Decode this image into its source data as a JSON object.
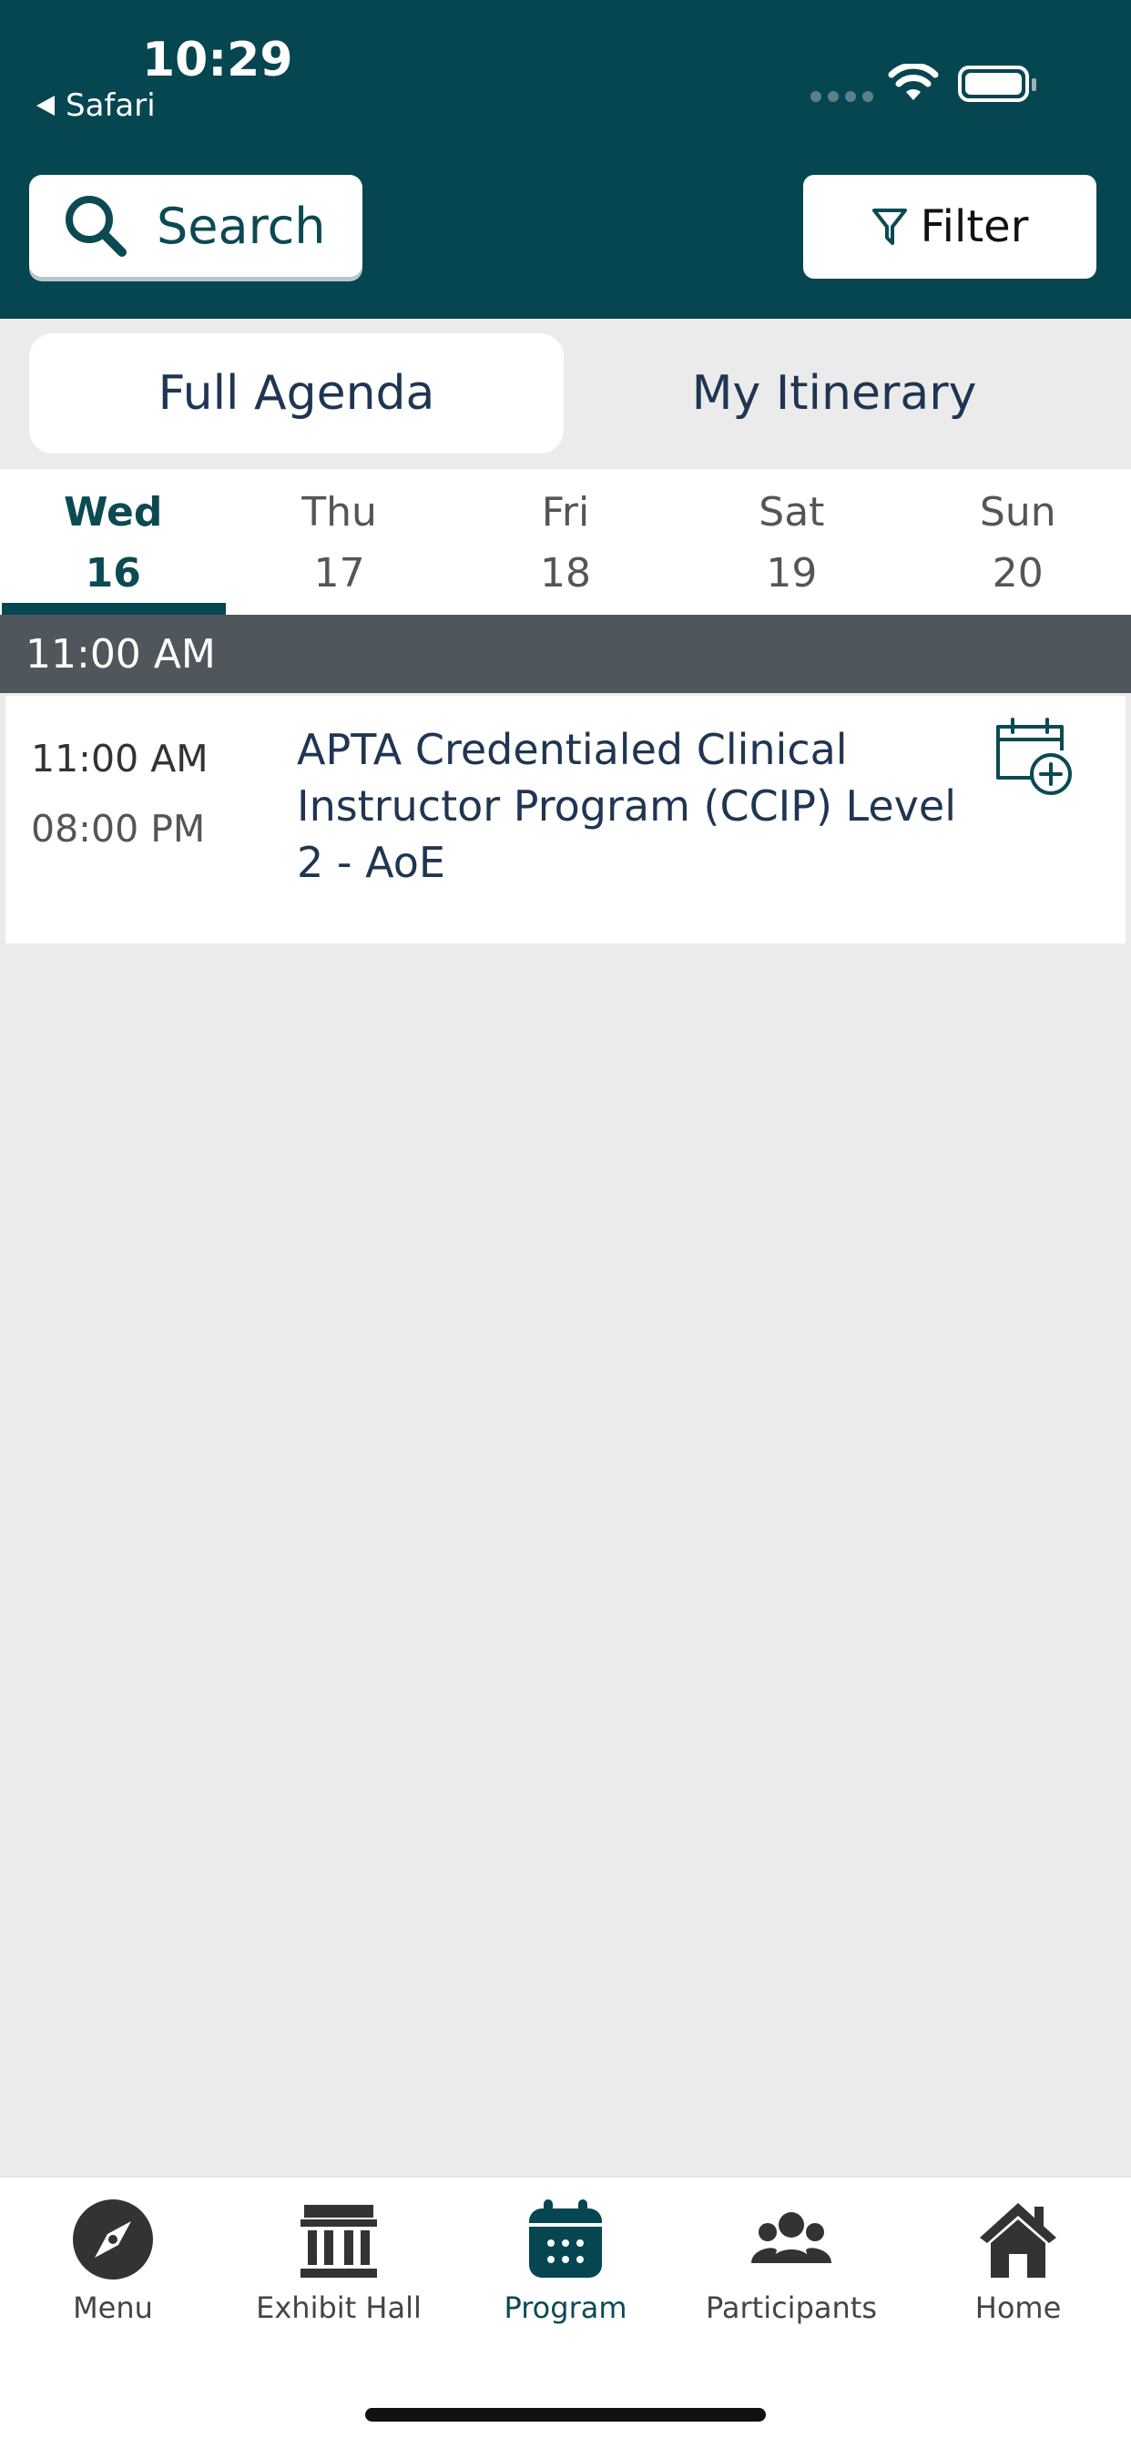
{
  "status": {
    "time": "10:29",
    "back_app": "Safari"
  },
  "header": {
    "search_label": "Search",
    "filter_label": "Filter"
  },
  "segments": {
    "active": "Full Agenda",
    "inactive": "My Itinerary"
  },
  "days": [
    {
      "dow": "Wed",
      "num": "16"
    },
    {
      "dow": "Thu",
      "num": "17"
    },
    {
      "dow": "Fri",
      "num": "18"
    },
    {
      "dow": "Sat",
      "num": "19"
    },
    {
      "dow": "Sun",
      "num": "20"
    }
  ],
  "timeslot": {
    "label": "11:00 AM"
  },
  "session": {
    "start": "11:00 AM",
    "end": "08:00 PM",
    "title": "APTA Credentialed Clinical Instructor Program (CCIP) Level 2 - AoE"
  },
  "nav": [
    {
      "label": "Menu",
      "icon": "compass-icon"
    },
    {
      "label": "Exhibit Hall",
      "icon": "building-icon"
    },
    {
      "label": "Program",
      "icon": "calendar-icon"
    },
    {
      "label": "Participants",
      "icon": "people-icon"
    },
    {
      "label": "Home",
      "icon": "home-icon"
    }
  ],
  "colors": {
    "brand": "#064651",
    "accent_text": "#0b4a53",
    "time_header": "#4f575d"
  }
}
